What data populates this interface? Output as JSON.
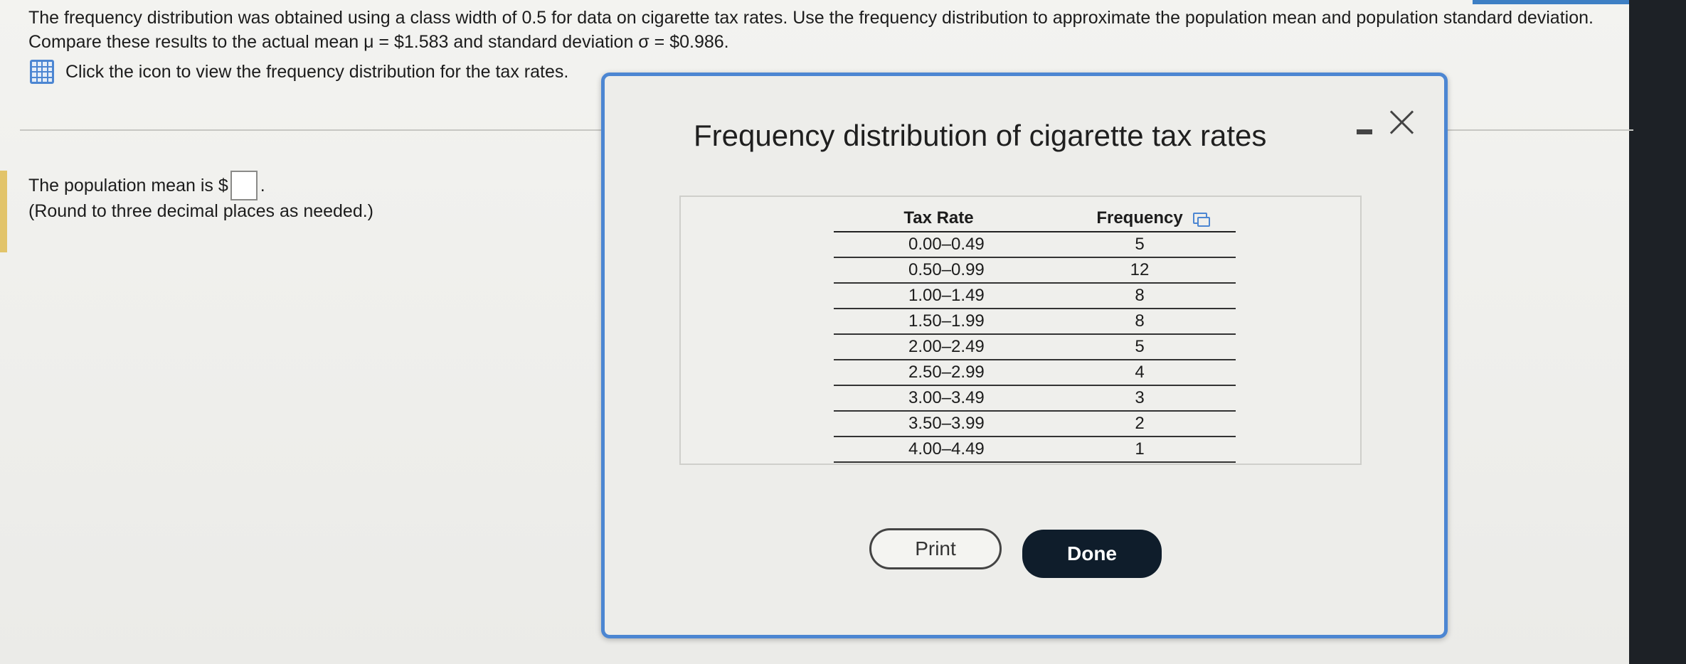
{
  "question": {
    "text": "The frequency distribution was obtained using a class width of 0.5 for data on cigarette tax rates. Use the frequency distribution to approximate the population mean and population standard deviation. Compare these results to the actual mean μ = $1.583 and standard deviation σ = $0.986.",
    "hint": "Click the icon to view the frequency distribution for the tax rates."
  },
  "answer": {
    "prompt": "The population mean is $",
    "suffix": ".",
    "value": "",
    "note": "(Round to three decimal places as needed.)"
  },
  "modal": {
    "title": "Frequency distribution of cigarette tax rates",
    "table": {
      "headers": [
        "Tax Rate",
        "Frequency"
      ],
      "rows": [
        {
          "rate": "0.00–0.49",
          "frequency": "5"
        },
        {
          "rate": "0.50–0.99",
          "frequency": "12"
        },
        {
          "rate": "1.00–1.49",
          "frequency": "8"
        },
        {
          "rate": "1.50–1.99",
          "frequency": "8"
        },
        {
          "rate": "2.00–2.49",
          "frequency": "5"
        },
        {
          "rate": "2.50–2.99",
          "frequency": "4"
        },
        {
          "rate": "3.00–3.49",
          "frequency": "3"
        },
        {
          "rate": "3.50–3.99",
          "frequency": "2"
        },
        {
          "rate": "4.00–4.49",
          "frequency": "1"
        }
      ]
    },
    "buttons": {
      "print": "Print",
      "done": "Done"
    }
  },
  "colors": {
    "accent": "#4c86d2",
    "done_bg": "#0f1d2b"
  }
}
